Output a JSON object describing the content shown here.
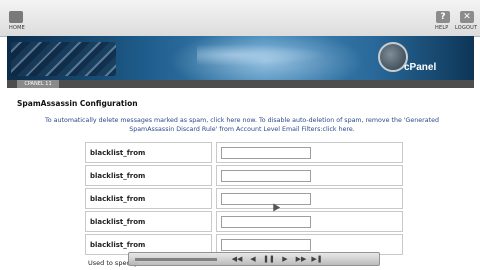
{
  "topbar": {
    "home_label": "HOME",
    "help_label": "HELP",
    "logout_label": "LOGOUT"
  },
  "banner": {
    "logo_text": "cPanel"
  },
  "breadcrumb": {
    "label": "CPANEL 11"
  },
  "page": {
    "title": "SpamAssassin Configuration",
    "description": "To automatically delete messages marked as spam, click here now. To disable auto-deletion of spam, remove the 'Generated SpamAssassin Discard Rule' from Account Level Email Filters:click here."
  },
  "form": {
    "rows": [
      {
        "label": "blacklist_from",
        "value": ""
      },
      {
        "label": "blacklist_from",
        "value": ""
      },
      {
        "label": "blacklist_from",
        "value": ""
      },
      {
        "label": "blacklist_from",
        "value": ""
      },
      {
        "label": "blacklist_from",
        "value": ""
      }
    ],
    "bottom_note": "Used to specify"
  },
  "player": {
    "rewind": "◀◀",
    "prev": "◀",
    "pause": "❚❚",
    "next": "▶",
    "forward": "▶▶",
    "end": "▶❚"
  }
}
